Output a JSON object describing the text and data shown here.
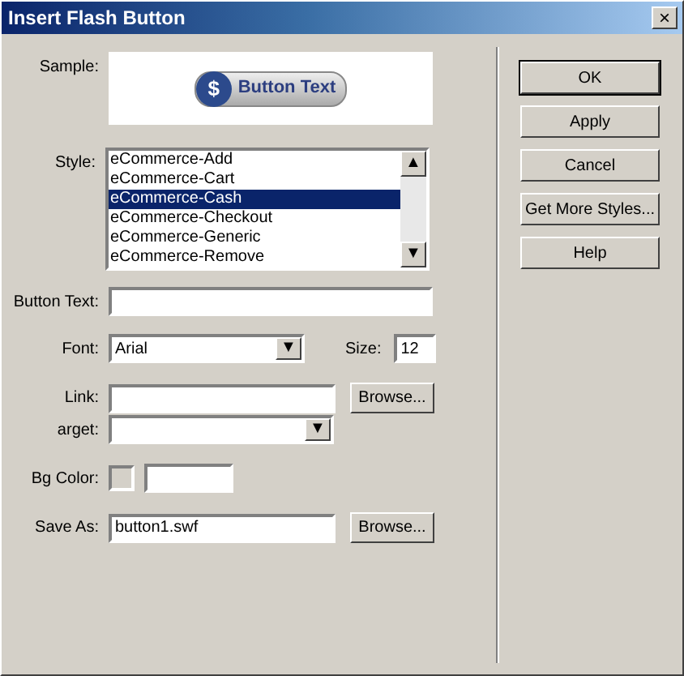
{
  "window": {
    "title": "Insert Flash Button",
    "close": "×"
  },
  "sample": {
    "label": "Sample:",
    "button_text": "Button Text",
    "symbol": "$"
  },
  "style": {
    "label": "Style:",
    "items": [
      {
        "text": "eCommerce-Add",
        "selected": false
      },
      {
        "text": "eCommerce-Cart",
        "selected": false
      },
      {
        "text": "eCommerce-Cash",
        "selected": true
      },
      {
        "text": "eCommerce-Checkout",
        "selected": false
      },
      {
        "text": "eCommerce-Generic",
        "selected": false
      },
      {
        "text": "eCommerce-Remove",
        "selected": false
      }
    ],
    "scroll_up": "▲",
    "scroll_down": "▼"
  },
  "button_text": {
    "label": "Button Text:"
  },
  "font": {
    "label": "Font:",
    "value": "Arial",
    "arrow": "▼"
  },
  "size": {
    "label": "Size:",
    "value": "12"
  },
  "link": {
    "label": "Link:",
    "browse": "Browse..."
  },
  "target": {
    "label": "arget:",
    "arrow": "▼"
  },
  "bg_color": {
    "label": "Bg Color:"
  },
  "save_as": {
    "label": "Save As:",
    "value": "button1.swf",
    "browse": "Browse..."
  },
  "buttons": [
    {
      "label": "OK",
      "default": true
    },
    {
      "label": "Apply",
      "default": false
    },
    {
      "label": "Cancel",
      "default": false
    },
    {
      "label": "Get More Styles...",
      "default": false
    },
    {
      "label": "Help",
      "default": false
    }
  ]
}
